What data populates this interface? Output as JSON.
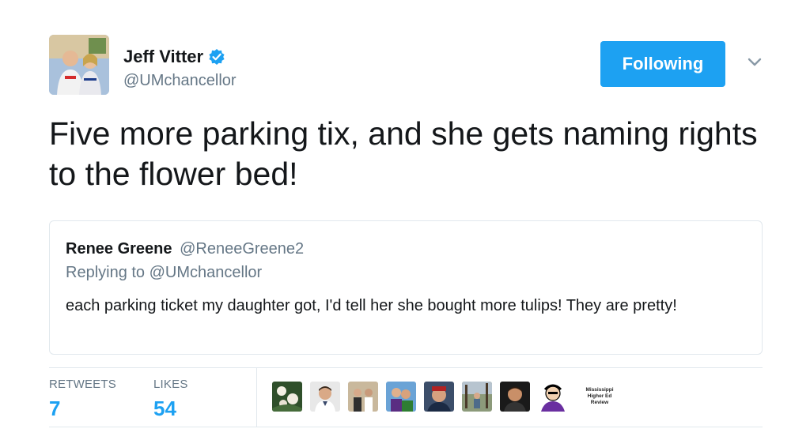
{
  "tweet": {
    "author": {
      "display_name": "Jeff Vitter",
      "handle": "@UMchancellor",
      "verified_icon": "verified-badge-icon",
      "avatar_icon": "profile-photo"
    },
    "follow_button_label": "Following",
    "menu_icon": "chevron-down-icon",
    "text": "Five more parking tix, and she gets naming rights to the flower bed!",
    "quoted": {
      "display_name": "Renee Greene",
      "handle": "@ReneeGreene2",
      "replying_to": "Replying to @UMchancellor",
      "text": "each parking ticket my daughter got, I'd tell her she bought more tulips! They are pretty!"
    },
    "stats": {
      "retweets_label": "RETWEETS",
      "retweets_count": "7",
      "likes_label": "LIKES",
      "likes_count": "54"
    },
    "likers": [
      {
        "icon": "flower-photo"
      },
      {
        "icon": "man-portrait"
      },
      {
        "icon": "group-photo"
      },
      {
        "icon": "costume-photo"
      },
      {
        "icon": "selfie-photo"
      },
      {
        "icon": "outdoor-photo"
      },
      {
        "icon": "dark-portrait"
      },
      {
        "icon": "cartoon-avatar"
      },
      {
        "icon": "logo-text",
        "text_line1": "Mississippi",
        "text_line2": "Higher Ed",
        "text_line3": "Review"
      }
    ],
    "colors": {
      "accent": "#1da1f2",
      "text_primary": "#14171a",
      "text_secondary": "#657786",
      "border": "#e1e8ed"
    }
  }
}
